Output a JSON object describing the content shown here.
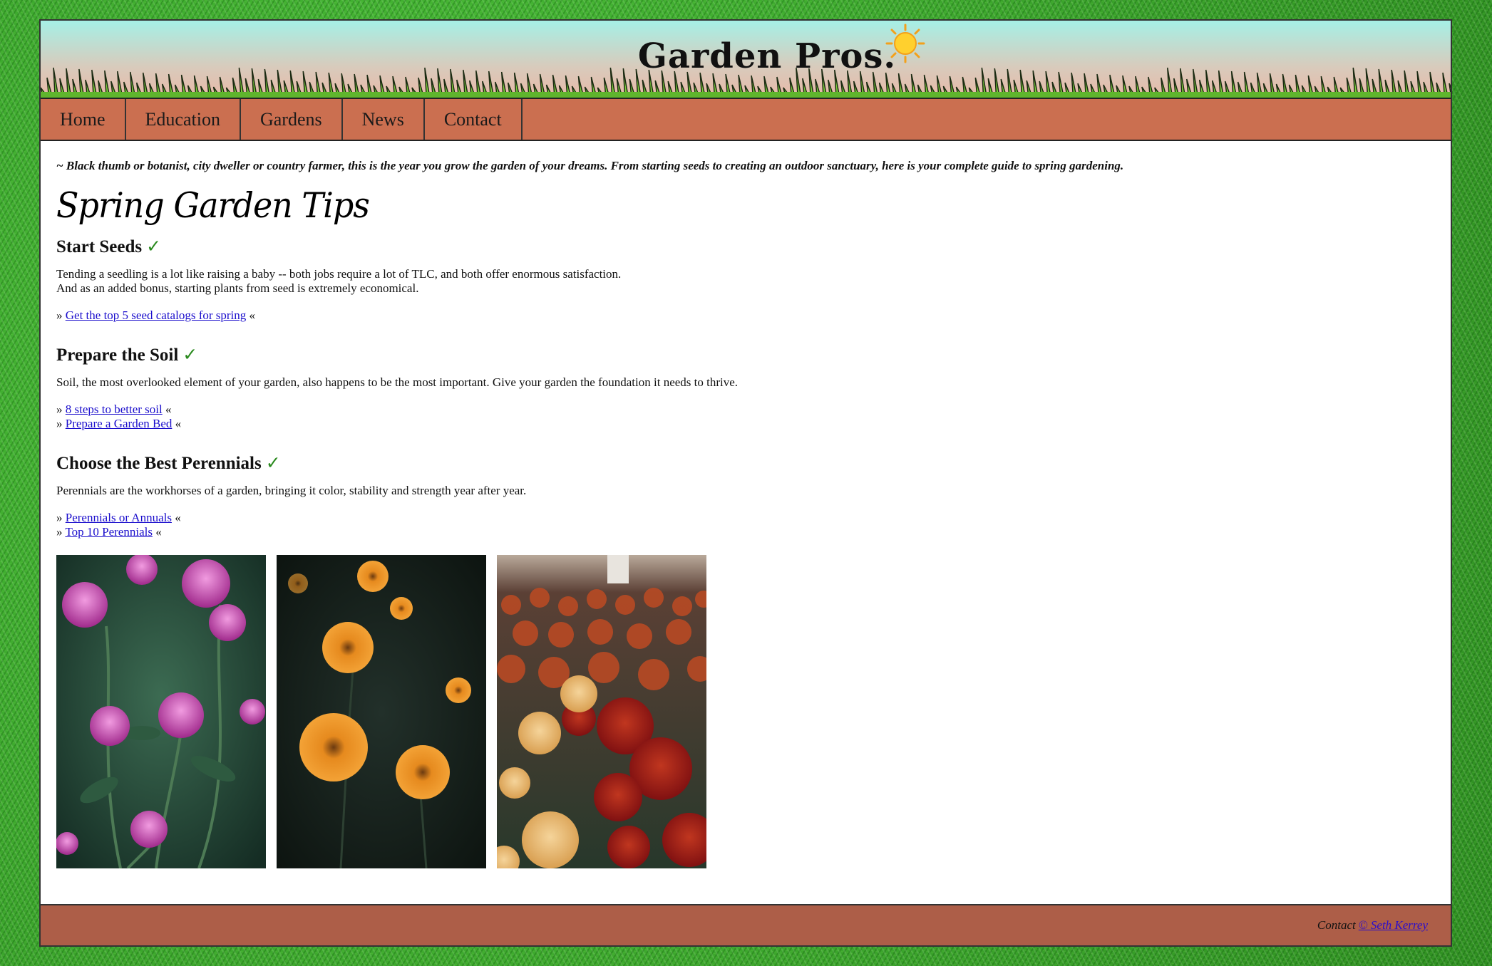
{
  "header": {
    "logo_text": "Garden Pros."
  },
  "nav": {
    "items": [
      "Home",
      "Education",
      "Gardens",
      "News",
      "Contact"
    ]
  },
  "intro": "~ Black thumb or botanist, city dweller or country farmer, this is the year you grow the garden of your dreams. From starting seeds to creating an outdoor sanctuary, here is your complete guide to spring gardening.",
  "page_title": "Spring Garden Tips",
  "check_mark": "✓",
  "sections": [
    {
      "heading": "Start Seeds",
      "body_line1": "Tending a seedling is a lot like raising a baby -- both jobs require a lot of TLC, and both offer enormous satisfaction.",
      "body_line2": "And as an added bonus, starting plants from seed is extremely economical.",
      "links": [
        "Get the top 5 seed catalogs for spring"
      ]
    },
    {
      "heading": "Prepare the Soil",
      "body_line1": "Soil, the most overlooked element of your garden, also happens to be the most important. Give your garden the foundation it needs to thrive.",
      "links": [
        "8 steps to better soil",
        "Prepare a Garden Bed"
      ]
    },
    {
      "heading": "Choose the Best Perennials",
      "body_line1": "Perennials are the workhorses of a garden, bringing it color, stability and strength year after year.",
      "links": [
        "Perennials or Annuals",
        "Top 10 Perennials"
      ]
    }
  ],
  "link_prefix": "»",
  "link_suffix": "«",
  "footer": {
    "label": "Contact",
    "link_text": "© Seth Kerrey"
  },
  "colors": {
    "nav_bg": "#cb6f50",
    "footer_bg": "#ad5e48",
    "check": "#2a8a1e",
    "link": "#1a0dcc"
  }
}
